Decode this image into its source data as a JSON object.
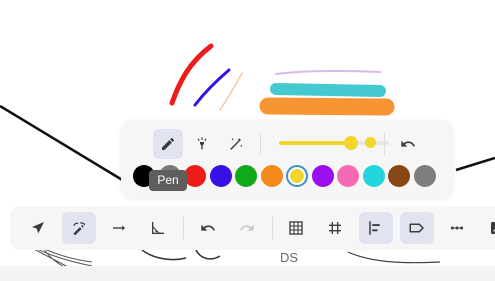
{
  "pen_panel": {
    "mode_tools": [
      {
        "id": "pen",
        "icon": "pen-icon",
        "active": true
      },
      {
        "id": "highlighter",
        "icon": "highlighter-icon",
        "active": false
      },
      {
        "id": "magic",
        "icon": "magic-wand-icon",
        "active": false
      }
    ],
    "stroke_size_fraction": 0.65,
    "undo_icon": "undo-icon",
    "colors": [
      {
        "name": "black",
        "hex": "#000000"
      },
      {
        "name": "gray-hidden",
        "hex": "#7a7a7a"
      },
      {
        "name": "red",
        "hex": "#ee1b1b"
      },
      {
        "name": "blue-violet",
        "hex": "#3a0fe6"
      },
      {
        "name": "green",
        "hex": "#12a81c"
      },
      {
        "name": "orange",
        "hex": "#f78a1d"
      },
      {
        "name": "yellow",
        "hex": "#f2d62b",
        "selected": true
      },
      {
        "name": "purple",
        "hex": "#9a0ef0"
      },
      {
        "name": "pink",
        "hex": "#f56bb3"
      },
      {
        "name": "cyan",
        "hex": "#24d4dc"
      },
      {
        "name": "brown",
        "hex": "#8a4716"
      },
      {
        "name": "gray",
        "hex": "#7e7e7e"
      }
    ],
    "tooltip": "Pen"
  },
  "toolbar": {
    "tools": [
      {
        "id": "select",
        "icon": "select-arrow-icon",
        "active": false
      },
      {
        "id": "draw",
        "icon": "pen-draw-icon",
        "active": true
      },
      {
        "id": "arrow",
        "icon": "arrow-right-icon",
        "active": false
      },
      {
        "id": "measure",
        "icon": "angle-measure-icon",
        "active": false
      },
      {
        "id": "undo",
        "icon": "undo-icon",
        "active": false
      },
      {
        "id": "redo",
        "icon": "redo-icon",
        "active": false,
        "disabled": true
      },
      {
        "id": "table",
        "icon": "table-grid-icon",
        "active": false
      },
      {
        "id": "grid",
        "icon": "grid-hash-icon",
        "active": false
      },
      {
        "id": "align-left",
        "icon": "align-left-icon",
        "active": true
      },
      {
        "id": "label",
        "icon": "label-tag-icon",
        "active": true
      },
      {
        "id": "more",
        "icon": "more-dots-icon",
        "active": false
      },
      {
        "id": "image",
        "icon": "image-icon",
        "active": false
      }
    ],
    "footer_label": "DS"
  },
  "accent_color": "#3d8fd8"
}
